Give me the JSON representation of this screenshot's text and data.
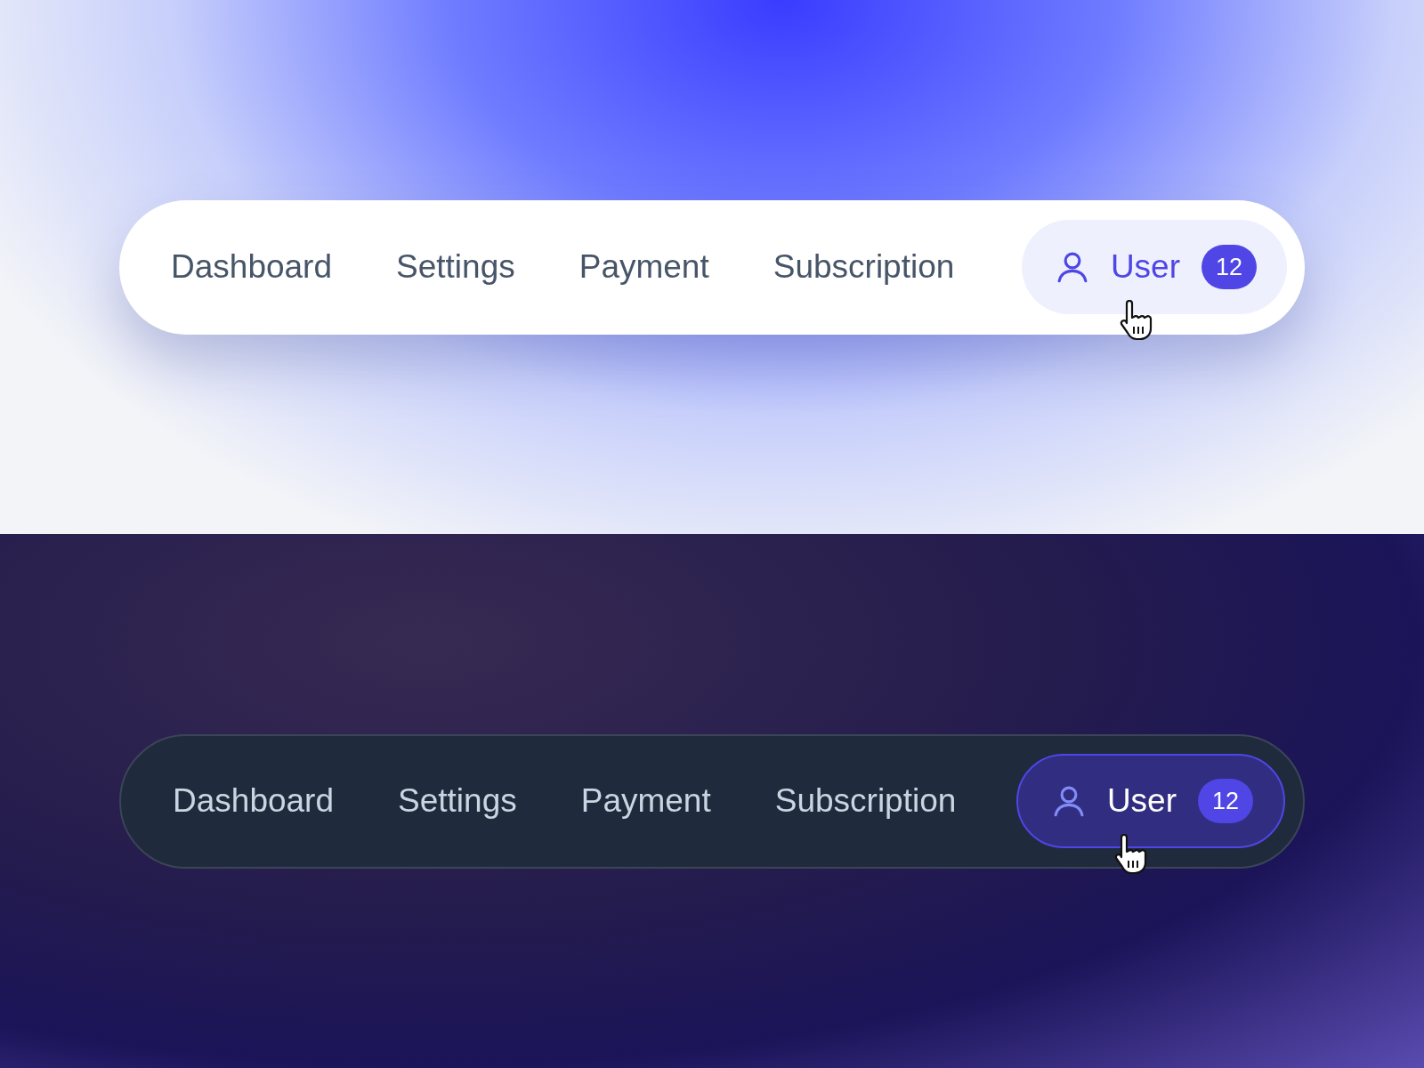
{
  "themes": [
    {
      "kind": "light",
      "items": [
        {
          "label": "Dashboard",
          "selected": false
        },
        {
          "label": "Settings",
          "selected": false
        },
        {
          "label": "Payment",
          "selected": false
        },
        {
          "label": "Subscription",
          "selected": false
        },
        {
          "label": "User",
          "selected": true,
          "badge": "12"
        }
      ]
    },
    {
      "kind": "dark",
      "items": [
        {
          "label": "Dashboard",
          "selected": false
        },
        {
          "label": "Settings",
          "selected": false
        },
        {
          "label": "Payment",
          "selected": false
        },
        {
          "label": "Subscription",
          "selected": false
        },
        {
          "label": "User",
          "selected": true,
          "badge": "12"
        }
      ]
    }
  ]
}
